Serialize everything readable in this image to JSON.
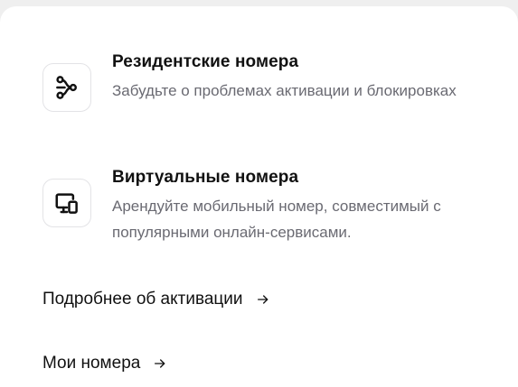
{
  "features": [
    {
      "title": "Резидентские номера",
      "description": "Забудьте о проблемах активации и блокировках",
      "icon": "network-nodes-icon"
    },
    {
      "title": "Виртуальные номера",
      "description": "Арендуйте мобильный номер, совместимый с популярными онлайн-сервисами.",
      "icon": "devices-icon"
    }
  ],
  "links": [
    {
      "label": "Подробнее об активации",
      "icon": "arrow-right-icon"
    },
    {
      "label": "Мои номера",
      "icon": "arrow-right-icon"
    }
  ],
  "colors": {
    "page_background": "#efefef",
    "panel_background": "#ffffff",
    "text_primary": "#111111",
    "text_secondary": "#6a6a72",
    "icon_border": "#e3e3e6"
  }
}
